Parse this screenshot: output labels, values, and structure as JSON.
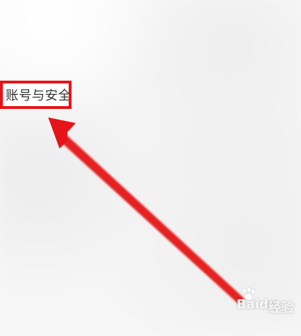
{
  "target_label": {
    "text": "账号与安全"
  },
  "watermark": {
    "brand": "Baidu",
    "suffix": "经验"
  },
  "colors": {
    "highlight": "#e51418",
    "arrow": "#e51418",
    "background": "#f7f7f7"
  },
  "icons": {
    "watermark_logo": "paw-icon"
  }
}
